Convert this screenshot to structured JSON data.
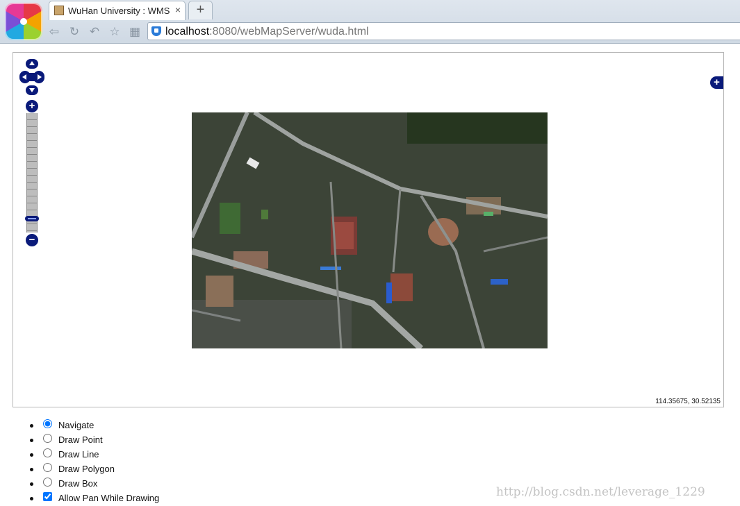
{
  "browser": {
    "tab": {
      "title": "WuHan University : WMS",
      "close_glyph": "×"
    },
    "new_tab_glyph": "+",
    "nav": {
      "back": "⇦",
      "reload": "↻",
      "undo": "↶",
      "bookmark": "☆",
      "apps": "▦"
    },
    "address": {
      "host": "localhost",
      "rest": ":8080/webMapServer/wuda.html"
    }
  },
  "map": {
    "coordinates": "114.35675, 30.52135",
    "zoom_level_fraction": 0.1,
    "layer_switcher_glyph": "+",
    "zoom_in_glyph": "+",
    "zoom_out_glyph": "−"
  },
  "controls": [
    {
      "label": "Navigate",
      "type": "radio",
      "checked": true
    },
    {
      "label": "Draw Point",
      "type": "radio",
      "checked": false
    },
    {
      "label": "Draw Line",
      "type": "radio",
      "checked": false
    },
    {
      "label": "Draw Polygon",
      "type": "radio",
      "checked": false
    },
    {
      "label": "Draw Box",
      "type": "radio",
      "checked": false
    },
    {
      "label": "Allow Pan While Drawing",
      "type": "checkbox",
      "checked": true
    }
  ],
  "watermark": "http://blog.csdn.net/leverage_1229",
  "colors": {
    "control_navy": "#0a1a7a",
    "map_border": "#b6b6b6"
  }
}
